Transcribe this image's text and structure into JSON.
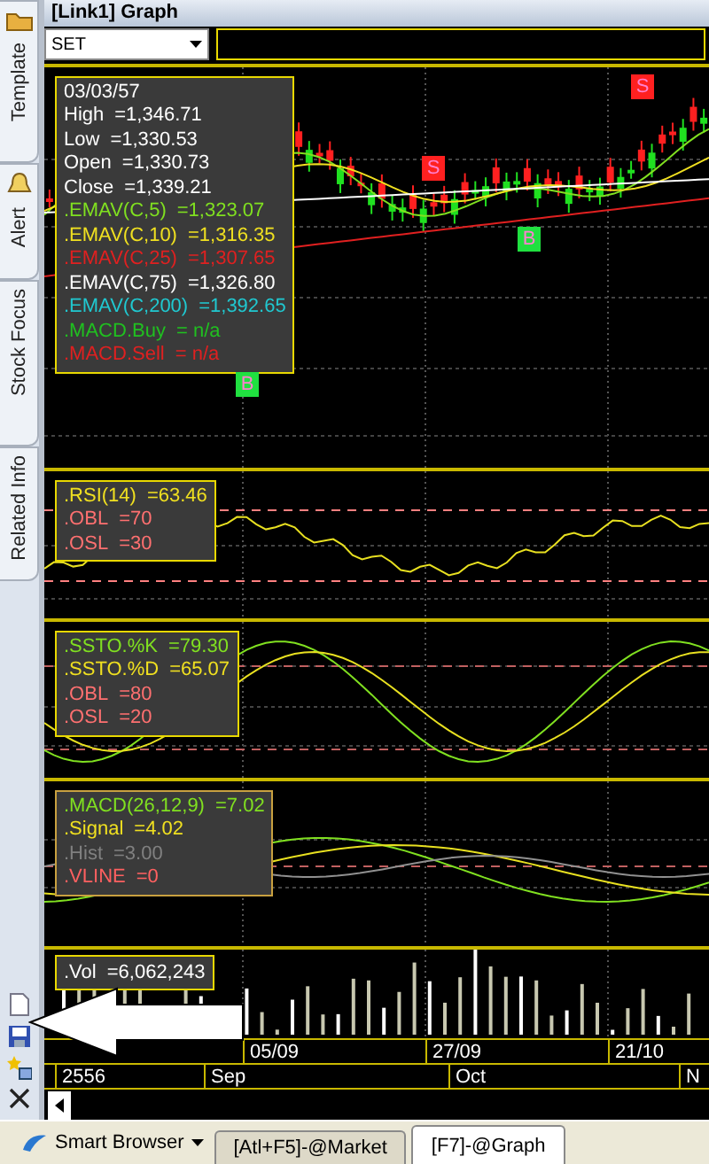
{
  "sidebar_tabs": [
    {
      "label": "Template"
    },
    {
      "label": "Alert"
    },
    {
      "label": "Stock Focus"
    },
    {
      "label": "Related Info"
    }
  ],
  "window": {
    "title": "[Link1] Graph"
  },
  "symbol_select": {
    "value": "SET"
  },
  "price_legend": {
    "date": "03/03/57",
    "lines": [
      {
        "label": "High",
        "value": "=1,346.71",
        "color": "#ffffff"
      },
      {
        "label": "Low",
        "value": "=1,330.53",
        "color": "#ffffff"
      },
      {
        "label": "Open",
        "value": "=1,330.73",
        "color": "#ffffff"
      },
      {
        "label": "Close",
        "value": "=1,339.21",
        "color": "#ffffff"
      },
      {
        "label": ".EMAV(C,5)",
        "value": "=1,323.07",
        "color": "#80e020"
      },
      {
        "label": ".EMAV(C,10)",
        "value": "=1,316.35",
        "color": "#f0e020"
      },
      {
        "label": ".EMAV(C,25)",
        "value": "=1,307.65",
        "color": "#e02020"
      },
      {
        "label": ".EMAV(C,75)",
        "value": "=1,326.80",
        "color": "#ffffff"
      },
      {
        "label": ".EMAV(C,200)",
        "value": "=1,392.65",
        "color": "#20c8d0"
      },
      {
        "label": ".MACD.Buy",
        "value": "= n/a",
        "color": "#20c020"
      },
      {
        "label": ".MACD.Sell",
        "value": "= n/a",
        "color": "#e02020"
      }
    ]
  },
  "markers": [
    {
      "label": "S",
      "kind": "sell"
    },
    {
      "label": "S",
      "kind": "sell"
    },
    {
      "label": "B",
      "kind": "buy"
    },
    {
      "label": "B",
      "kind": "buy"
    }
  ],
  "rsi_legend": {
    "lines": [
      {
        "label": ".RSI(14)",
        "value": "=63.46",
        "color": "#f0e020"
      },
      {
        "label": ".OBL",
        "value": "=70",
        "color": "#ff7070"
      },
      {
        "label": ".OSL",
        "value": "=30",
        "color": "#ff7070"
      }
    ]
  },
  "ssto_legend": {
    "lines": [
      {
        "label": ".SSTO.%K",
        "value": "=79.30",
        "color": "#80e020"
      },
      {
        "label": ".SSTO.%D",
        "value": "=65.07",
        "color": "#f0e020"
      },
      {
        "label": ".OBL",
        "value": "=80",
        "color": "#ff7070"
      },
      {
        "label": ".OSL",
        "value": "=20",
        "color": "#ff7070"
      }
    ]
  },
  "macd_legend": {
    "lines": [
      {
        "label": ".MACD(26,12,9)",
        "value": "=7.02",
        "color": "#80e020"
      },
      {
        "label": ".Signal",
        "value": "=4.02",
        "color": "#f0e020"
      },
      {
        "label": ".Hist",
        "value": "=3.00",
        "color": "#808080"
      },
      {
        "label": ".VLINE",
        "value": "=0",
        "color": "#ff6060"
      }
    ]
  },
  "volume_legend": {
    "lines": [
      {
        "label": ".Vol",
        "value": "=6,062,243",
        "color": "#ffffff"
      }
    ]
  },
  "date_axis": [
    "05/09",
    "27/09",
    "21/10"
  ],
  "month_axis": [
    "2556",
    "Sep",
    "Oct",
    "N"
  ],
  "taskbar": {
    "menu": "Smart Browser",
    "tabs": [
      {
        "label": "[Atl+F5]-@Market",
        "selected": false
      },
      {
        "label": "[F7]-@Graph",
        "selected": true
      }
    ]
  }
}
